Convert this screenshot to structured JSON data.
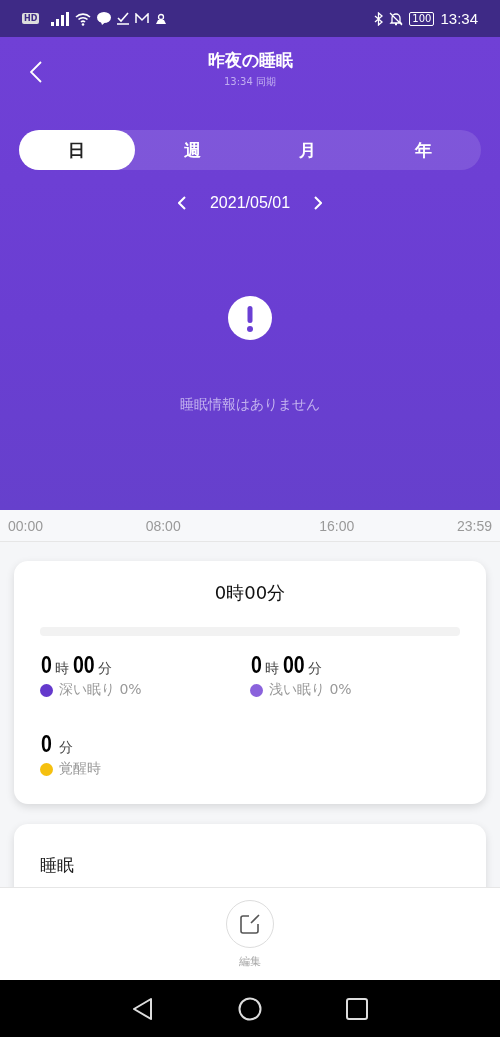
{
  "status_bar": {
    "badge": "HD",
    "battery": "100",
    "time": "13:34"
  },
  "header": {
    "title": "昨夜の睡眠",
    "subtitle": "13:34 同期"
  },
  "tabs": [
    {
      "label": "日",
      "selected": true
    },
    {
      "label": "週",
      "selected": false
    },
    {
      "label": "月",
      "selected": false
    },
    {
      "label": "年",
      "selected": false
    }
  ],
  "date_nav": {
    "date": "2021/05/01"
  },
  "empty_state": {
    "message": "睡眠情報はありません"
  },
  "timeline": {
    "labels": [
      "00:00",
      "08:00",
      "16:00",
      "23:59"
    ]
  },
  "summary": {
    "total": "0時00分",
    "stages": [
      {
        "kind": "hm",
        "hours": "0",
        "hours_unit": "時",
        "minutes": "00",
        "minutes_unit": "分",
        "label": "深い眠り 0%",
        "color": "#6439cc"
      },
      {
        "kind": "hm",
        "hours": "0",
        "hours_unit": "時",
        "minutes": "00",
        "minutes_unit": "分",
        "label": "浅い眠り 0%",
        "color": "#8a62dc"
      },
      {
        "kind": "m",
        "minutes": "0",
        "minutes_unit": "分",
        "label": "覚醒時",
        "color": "#f5c00f"
      }
    ]
  },
  "section": {
    "title": "睡眠"
  },
  "bottom_action": {
    "label": "編集"
  }
}
